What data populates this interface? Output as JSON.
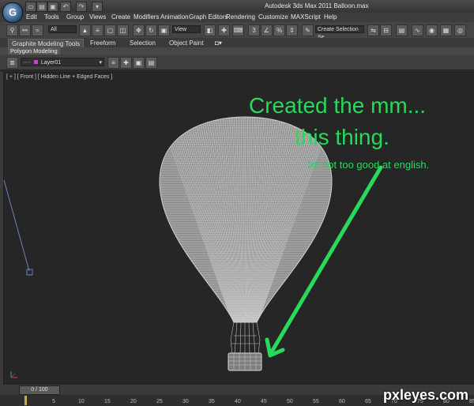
{
  "app": {
    "title": "Autodesk 3ds Max 2011    Balloon.max",
    "logo": "G"
  },
  "quick_access": [
    "new-icon",
    "open-icon",
    "save-icon",
    "undo-icon",
    "redo-icon",
    "project-icon"
  ],
  "menu": [
    "Edit",
    "Tools",
    "Group",
    "Views",
    "Create",
    "Modifiers",
    "Animation",
    "Graph Editors",
    "Rendering",
    "Customize",
    "MAXScript",
    "Help"
  ],
  "toolbar": {
    "selection_filter": "All",
    "reference_coord": "View",
    "named_selection": "Create Selection Se"
  },
  "ribbon": {
    "tabs": [
      "Graphite Modeling Tools",
      "Freeform",
      "Selection",
      "Object Paint"
    ],
    "active_tab": "Graphite Modeling Tools",
    "panel": "Polygon Modeling"
  },
  "layer": {
    "name": "Layer01"
  },
  "viewport": {
    "label": "[ + ] [ Front ] [ Hidden Line + Edged Faces ]"
  },
  "annotation": {
    "line1": "Created the mm...",
    "line2": "this thing.",
    "line3": "Im not too good at english.",
    "color": "#28d95a"
  },
  "timeline": {
    "slider": "0 / 100",
    "ticks": [
      "5",
      "10",
      "15",
      "20",
      "25",
      "30",
      "35",
      "40",
      "45",
      "50",
      "55",
      "60",
      "65",
      "70",
      "75",
      "80",
      "85"
    ]
  },
  "watermark": "pxleyes.com"
}
